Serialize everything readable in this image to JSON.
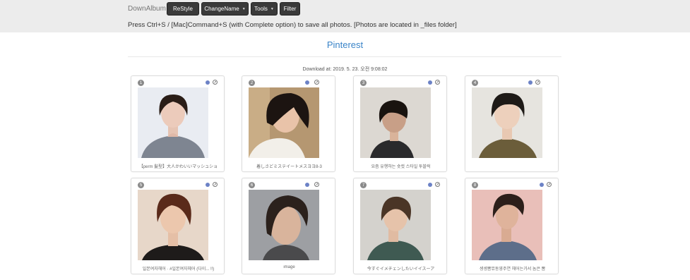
{
  "toolbar": {
    "brand": "DownAlbum",
    "restyle": "ReStyle",
    "changename": "ChangeName",
    "tools": "Tools",
    "filter": "Filter"
  },
  "hint": "Press Ctrl+S / [Mac]Command+S (with Complete option) to save all photos. [Photos are located in _files folder]",
  "title": "Pinterest",
  "download_at": "Download at: 2019. 5. 23. 오전 9:08:02",
  "cards": [
    {
      "num": "1",
      "caption": "【perm 髪型】大人かわいいマッシュショ"
    },
    {
      "num": "2",
      "caption": "着しさどミステイートメスヨヨ8-3"
    },
    {
      "num": "3",
      "caption": "요즘 유행하는 숏컷 스타일 투블럭"
    },
    {
      "num": "4",
      "caption": ""
    },
    {
      "num": "5",
      "caption": "일본여자헤어 · #일본여자헤어 (다이... !!)"
    },
    {
      "num": "6",
      "caption": "image"
    },
    {
      "num": "7",
      "caption": "今すぐイメチェンしたいイイスーア"
    },
    {
      "num": "8",
      "caption": "셍셍뽐뮤동영주연 헤어는가서 놈은 뽐"
    }
  ],
  "colors": {
    "accent": "#3a84c8",
    "dot": "#6c82c6"
  }
}
